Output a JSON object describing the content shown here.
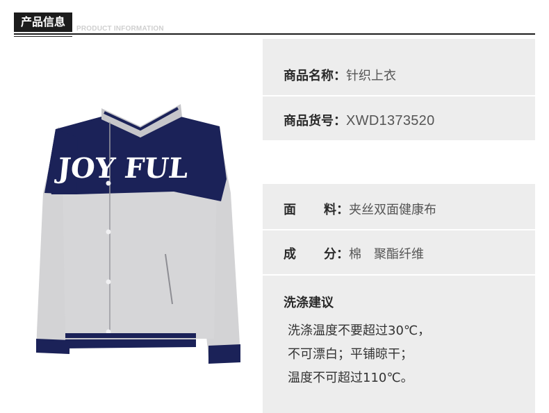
{
  "header": {
    "title": "产品信息",
    "subtitle": "PRODUCT INFORMATION"
  },
  "product_image": {
    "print_text": "JOY FUL",
    "colors": {
      "navy": "#1b2258",
      "heather_grey": "#d4d4d6"
    }
  },
  "info": {
    "name": {
      "label": "商品名称",
      "value": "针织上衣"
    },
    "sku": {
      "label": "商品货号",
      "value": "XWD1373520"
    },
    "fabric": {
      "label_a": "面",
      "label_b": "料",
      "value": "夹丝双面健康布"
    },
    "composition": {
      "label_a": "成",
      "label_b": "分",
      "value": "棉　聚酯纤维"
    }
  },
  "care": {
    "title": "洗涤建议",
    "lines": [
      "洗涤温度不要超过30℃，",
      "不可漂白；平铺晾干；",
      "温度不可超过110℃。"
    ]
  },
  "colors": {
    "row_grey": "#ededed",
    "header_dark": "#1c1c1c"
  }
}
